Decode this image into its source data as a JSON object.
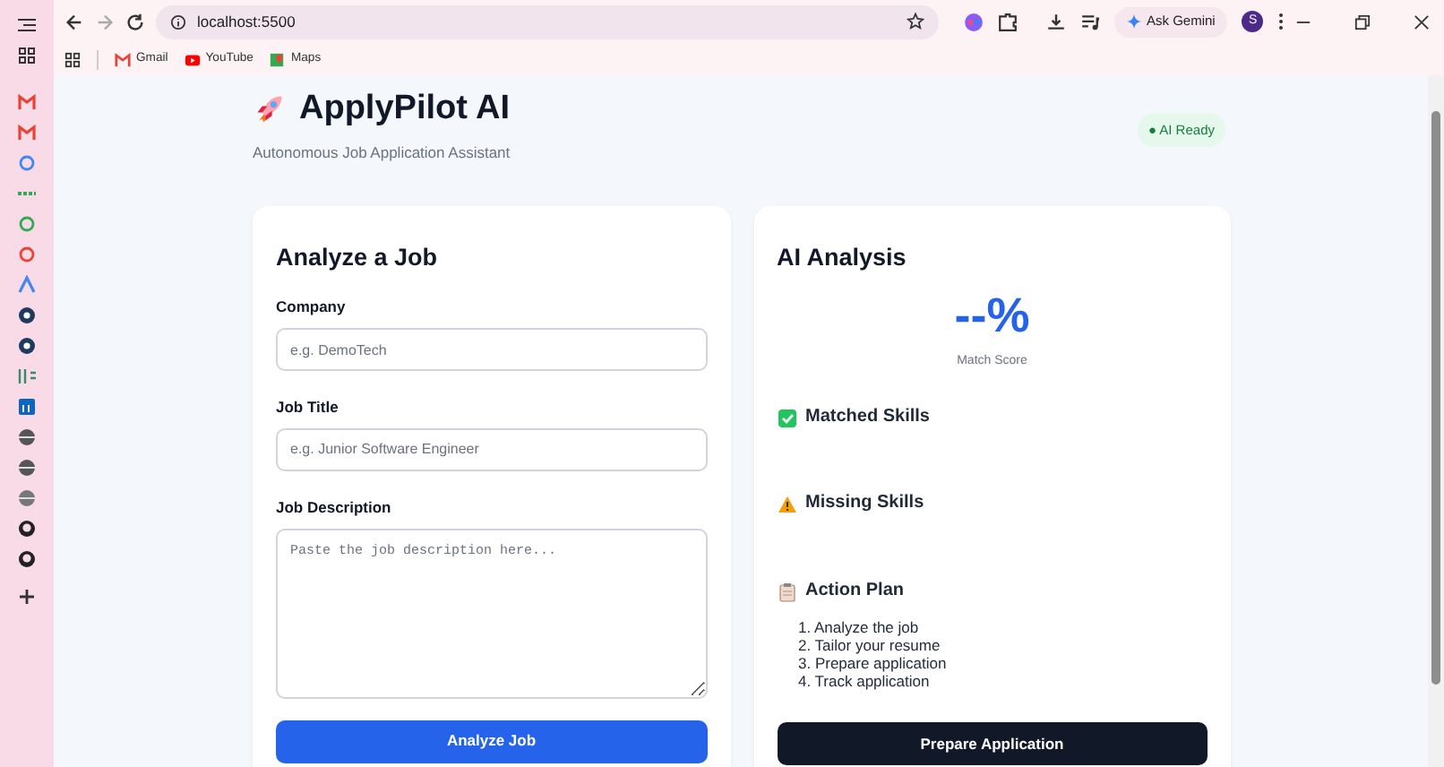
{
  "browser": {
    "address": "localhost:5500",
    "gemini_button": "Ask Gemini",
    "profile_initial": "S",
    "bookmarks": [
      {
        "kind": "gmail",
        "label": "Gmail"
      },
      {
        "kind": "youtube",
        "label": "YouTube"
      },
      {
        "kind": "maps",
        "label": "Maps"
      }
    ]
  },
  "header": {
    "title": "ApplyPilot AI",
    "subtitle": "Autonomous Job Application Assistant",
    "status": "● AI Ready"
  },
  "form": {
    "title": "Analyze a Job",
    "fields": [
      {
        "kind": "input",
        "label": "Company",
        "placeholder": "e.g. DemoTech"
      },
      {
        "kind": "input",
        "label": "Job Title",
        "placeholder": "e.g. Junior Software Engineer"
      },
      {
        "kind": "textarea",
        "label": "Job Description",
        "placeholder": "Paste the job description here..."
      }
    ],
    "button": "Analyze Job"
  },
  "analysis": {
    "title": "AI Analysis",
    "score": "--%",
    "score_label": "Match Score",
    "sections": [
      {
        "kind": "matched",
        "title": "Matched Skills"
      },
      {
        "kind": "missing",
        "title": "Missing Skills"
      },
      {
        "kind": "plan",
        "title": "Action Plan",
        "steps": [
          "1. Analyze the job",
          "2. Tailor your resume",
          "3. Prepare application",
          "4. Track application"
        ]
      }
    ],
    "button": "Prepare Application"
  }
}
